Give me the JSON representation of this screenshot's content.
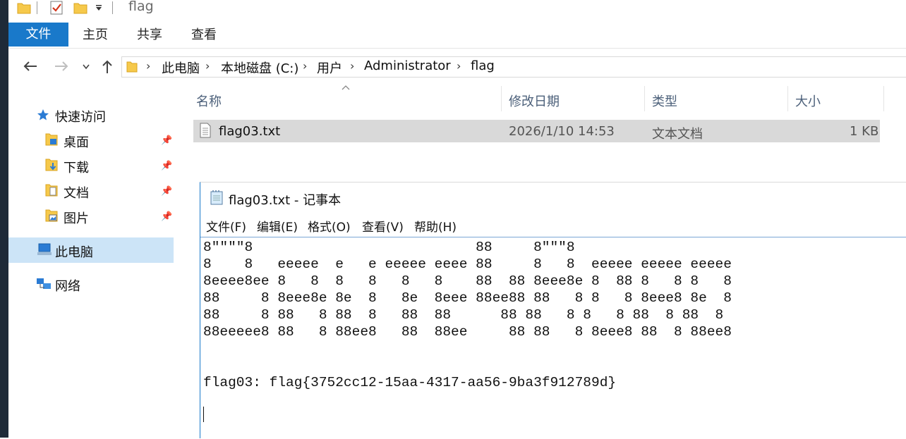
{
  "window": {
    "title": "flag"
  },
  "ribbon": {
    "tabs": [
      "文件",
      "主页",
      "共享",
      "查看"
    ]
  },
  "address": {
    "crumbs": [
      "此电脑",
      "本地磁盘 (C:)",
      "用户",
      "Administrator",
      "flag"
    ]
  },
  "sidebar": {
    "quick_access": "快速访问",
    "items": [
      "桌面",
      "下载",
      "文档",
      "图片"
    ],
    "this_pc": "此电脑",
    "network": "网络"
  },
  "list": {
    "columns": [
      "名称",
      "修改日期",
      "类型",
      "大小"
    ],
    "rows": [
      {
        "name": "flag03.txt",
        "date": "2026/1/10 14:53",
        "type": "文本文档",
        "size": "1 KB"
      }
    ]
  },
  "notepad": {
    "title": "flag03.txt - 记事本",
    "menu": [
      "文件(F)",
      "编辑(E)",
      "格式(O)",
      "查看(V)",
      "帮助(H)"
    ],
    "content": "8\"\"\"\"8                           88     8\"\"\"8\n8    8   eeeee  e   e eeeee eeee 88     8   8  eeeee eeeee eeeee\n8eeee8ee 8   8  8   8   8   8    88  88 8eee8e 8  88 8   8 8   8\n88     8 8eee8e 8e  8   8e  8eee 88ee88 88   8 8   8 8eee8 8e  8\n88     8 88   8 88  8   88  88      88 88   8 8   8 88  8 88  8\n88eeeee8 88   8 88ee8   88  88ee     88 88   8 8eee8 88  8 88ee8\n\n\nflag03: flag{3752cc12-15aa-4317-aa56-9ba3f912789d}"
  }
}
